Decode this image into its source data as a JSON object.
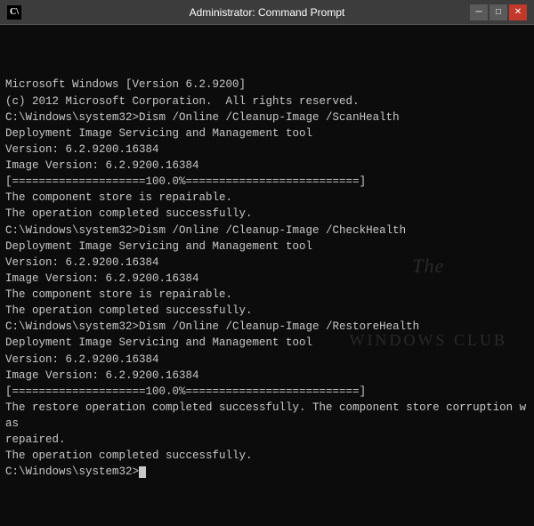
{
  "titlebar": {
    "icon_label": "C\\",
    "title": "Administrator: Command Prompt",
    "minimize_label": "─",
    "maximize_label": "□",
    "close_label": "✕"
  },
  "terminal": {
    "lines": [
      "Microsoft Windows [Version 6.2.9200]",
      "(c) 2012 Microsoft Corporation.  All rights reserved.",
      "",
      "C:\\Windows\\system32>Dism /Online /Cleanup-Image /ScanHealth",
      "",
      "Deployment Image Servicing and Management tool",
      "Version: 6.2.9200.16384",
      "",
      "Image Version: 6.2.9200.16384",
      "",
      "[====================100.0%==========================]",
      "The component store is repairable.",
      "The operation completed successfully.",
      "",
      "C:\\Windows\\system32>Dism /Online /Cleanup-Image /CheckHealth",
      "",
      "Deployment Image Servicing and Management tool",
      "Version: 6.2.9200.16384",
      "",
      "Image Version: 6.2.9200.16384",
      "",
      "The component store is repairable.",
      "The operation completed successfully.",
      "",
      "C:\\Windows\\system32>Dism /Online /Cleanup-Image /RestoreHealth",
      "",
      "Deployment Image Servicing and Management tool",
      "Version: 6.2.9200.16384",
      "",
      "Image Version: 6.2.9200.16384",
      "",
      "[====================100.0%==========================]",
      "The restore operation completed successfully. The component store corruption was",
      "repaired.",
      "The operation completed successfully.",
      "",
      "C:\\Windows\\system32>"
    ],
    "cursor_visible": true
  },
  "watermark": {
    "line1": "The",
    "line2": "Windows Club",
    "icon": "⊞"
  }
}
